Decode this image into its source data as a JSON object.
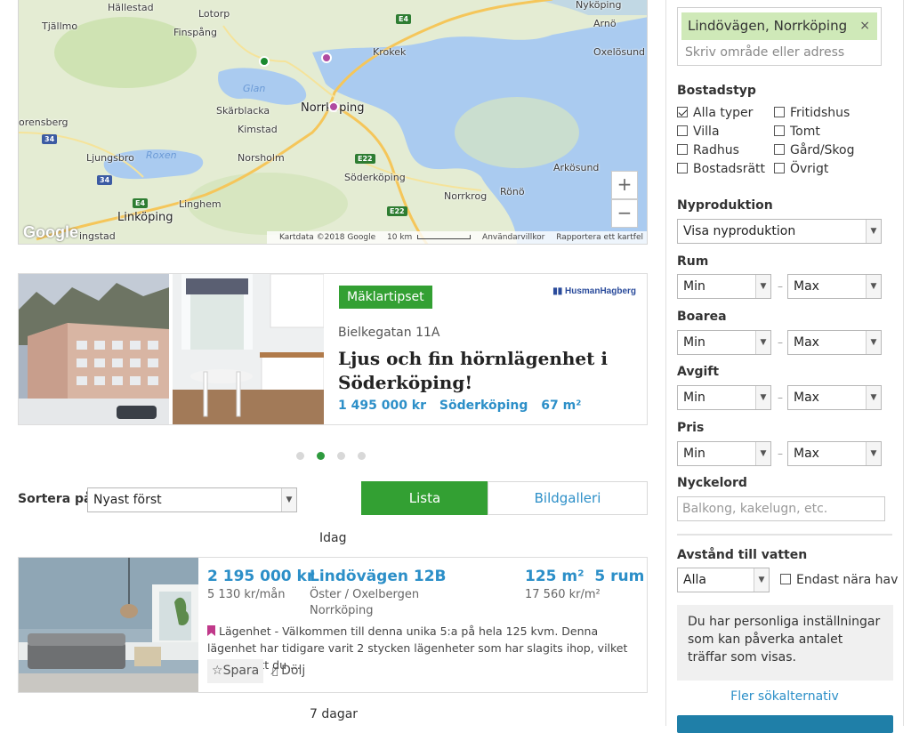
{
  "map": {
    "places": {
      "hallestad": "Hällestad",
      "lotorp": "Lotorp",
      "tjallmo": "Tjällmo",
      "finspang": "Finspång",
      "krokek": "Krokek",
      "nykoping": "Nyköping",
      "arno": "Arnö",
      "oxelosund": "Oxelösund",
      "glan": "Glan",
      "skarblacka": "Skärblacka",
      "norrkoping": "Norrköping",
      "kimstad": "Kimstad",
      "orensberg": "orensberg",
      "ljungsbro": "Ljungsbro",
      "roxen": "Roxen",
      "norsholm": "Norsholm",
      "soderkoping": "Söderköping",
      "arkosund": "Arkösund",
      "norrkrog": "Norrkrog",
      "rono": "Rönö",
      "linghem": "Linghem",
      "linkoping": "Linköping",
      "ingstad": "ingstad"
    },
    "road_labels": {
      "e4_top": "E4",
      "r34_a": "34",
      "r34_b": "34",
      "e22_a": "E22",
      "e22_b": "E22",
      "e4_bottom": "E4"
    },
    "zoom_in": "+",
    "zoom_out": "−",
    "google_logo": "Google",
    "footer": {
      "data": "Kartdata ©2018 Google",
      "scale": "10 km",
      "terms": "Användarvillkor",
      "report": "Rapportera ett kartfel"
    },
    "pin_colors": {
      "green": "#1a8a2e",
      "purple": "#b04aa1"
    }
  },
  "featured": {
    "badge": "Mäklartipset",
    "broker": "HusmanHagberg",
    "street": "Bielkegatan 11A",
    "title": "Ljus och fin hörnlägenhet i Söderköping!",
    "price": "1 495 000 kr",
    "city": "Söderköping",
    "size": "67 m²",
    "carousel_active_index": 2,
    "carousel_count": 4
  },
  "sort": {
    "label": "Sortera på",
    "value": "Nyast först",
    "tab_list": "Lista",
    "tab_gallery": "Bildgalleri"
  },
  "groups": {
    "today": "Idag",
    "seven_days": "7 dagar"
  },
  "listing": {
    "price": "2 195 000 kr",
    "price_per_month": "5 130 kr/mån",
    "address": "Lindövägen 12B",
    "area": "Öster / Oxelbergen",
    "city": "Norrköping",
    "size": "125 m²",
    "rooms": "5 rum",
    "price_per_sqm": "17 560 kr/m²",
    "description": "Lägenhet - Välkommen till denna unika 5:a på hela 125 kvm. Denna lägenhet har tidigare varit 2 stycken lägenheter som har slagits ihop, vilket innebär att du ...",
    "save": "Spara",
    "hide": "Dölj"
  },
  "sidebar": {
    "tag": "Lindövägen, Norrköping",
    "tag_close": "×",
    "search_placeholder": "Skriv område eller adress",
    "housing_label": "Bostadstyp",
    "types": {
      "all": "Alla typer",
      "villa": "Villa",
      "radhus": "Radhus",
      "bostadsratt": "Bostadsrätt",
      "fritidshus": "Fritidshus",
      "tomt": "Tomt",
      "gard": "Gård/Skog",
      "ovrigt": "Övrigt"
    },
    "new_label": "Nyproduktion",
    "new_value": "Visa nyproduktion",
    "rooms_label": "Rum",
    "area_label": "Boarea",
    "fee_label": "Avgift",
    "price_label": "Pris",
    "min": "Min",
    "max": "Max",
    "dash": "–",
    "keyword_label": "Nyckelord",
    "keyword_placeholder": "Balkong, kakelugn, etc.",
    "water_label": "Avstånd till vatten",
    "water_value": "Alla",
    "sea_only": "Endast nära hav",
    "info": "Du har personliga inställningar som kan påverka antalet träffar som visas.",
    "more": "Fler sökalternativ"
  }
}
